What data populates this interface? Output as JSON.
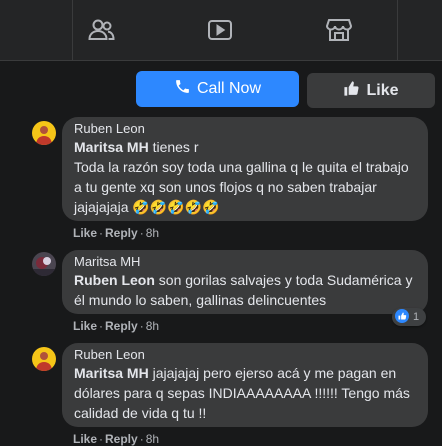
{
  "nav": {
    "tabs": [
      {
        "icon": "friends-icon"
      },
      {
        "icon": "watch-icon"
      },
      {
        "icon": "marketplace-icon"
      }
    ]
  },
  "actions_bar": {
    "call_label": "Call Now",
    "like_label": "Like"
  },
  "comments": [
    {
      "author": "Ruben Leon",
      "mention": "Maritsa MH",
      "text_after_mention": " tienes r",
      "body": "Toda la razón soy toda una gallina q le quita el trabajo a tu gente xq son unos flojos q no saben trabajar jajajajaja 🤣🤣🤣🤣🤣",
      "like_label": "Like",
      "reply_label": "Reply",
      "time": "8h"
    },
    {
      "author": "Maritsa MH",
      "mention": "Ruben Leon",
      "text_after_mention": " son gorilas salvajes y toda Sudamérica y él mundo lo saben, gallinas delincuentes",
      "like_label": "Like",
      "reply_label": "Reply",
      "time": "8h",
      "reaction_count": "1"
    },
    {
      "author": "Ruben Leon",
      "mention": "Maritsa MH",
      "text_after_mention": " jajajajaj pero ejerso acá y me pagan en dólares para q sepas INDIAAAAAAAA !!!!!! Tengo más calidad de vida q tu !!",
      "like_label": "Like",
      "reply_label": "Reply",
      "time": "8h"
    }
  ],
  "colors": {
    "accent": "#2d88ff",
    "bubble": "#3a3b3c",
    "background": "#18191a"
  }
}
